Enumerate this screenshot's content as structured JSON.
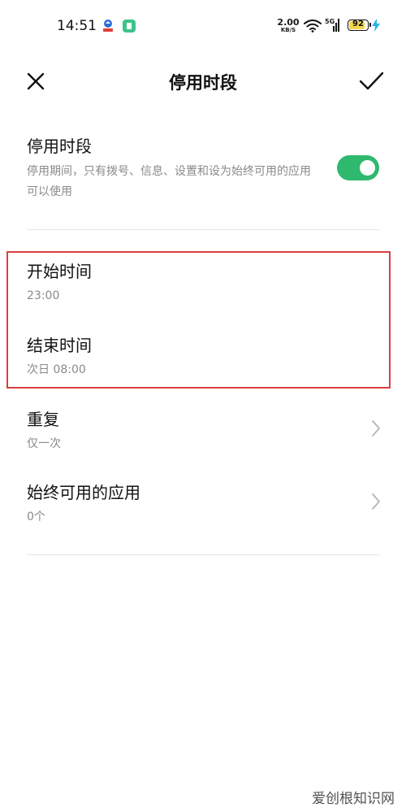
{
  "status_bar": {
    "time": "14:51",
    "net_speed_value": "2.00",
    "net_speed_unit": "KB/S",
    "signal_label": "5G",
    "battery_level": "92",
    "battery_fraction": 0.92,
    "icons": [
      "app-notification-icon",
      "app-green-icon",
      "wifi-icon",
      "cell-signal-icon",
      "battery-icon",
      "charging-bolt-icon"
    ]
  },
  "header": {
    "title": "停用时段",
    "close_icon": "close-icon",
    "confirm_icon": "checkmark-icon"
  },
  "settings": {
    "downtime": {
      "title": "停用时段",
      "description": "停用期间，只有拨号、信息、设置和设为始终可用的应用可以使用",
      "enabled": true
    },
    "start_time": {
      "title": "开始时间",
      "value": "23:00"
    },
    "end_time": {
      "title": "结束时间",
      "value": "次日 08:00"
    },
    "repeat": {
      "title": "重复",
      "value": "仅一次"
    },
    "always_allowed": {
      "title": "始终可用的应用",
      "value": "0个"
    }
  },
  "colors": {
    "toggle_on": "#2fb96f",
    "highlight_border": "#d7403f",
    "battery_fill": "#f2d64b"
  },
  "watermark": "爱创根知识网"
}
